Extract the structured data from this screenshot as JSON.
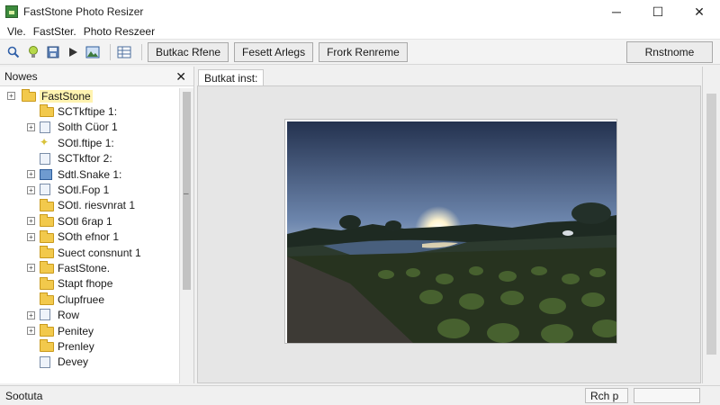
{
  "window": {
    "title": "FastStone Photo Resizer",
    "minimize_glyph": "─",
    "maximize_glyph": "☐",
    "close_glyph": "✕"
  },
  "menu": [
    "Vle.",
    "FastSter.",
    "Photo Reszeer"
  ],
  "toolbar": {
    "icons": [
      "search-icon",
      "bulb-icon",
      "save-icon",
      "play-icon",
      "image-icon",
      "grid-icon"
    ],
    "buttons": [
      "Butkac Rfene",
      "Fesett Arlegs",
      "Frork Renreme"
    ],
    "right_button": "Rnstnome"
  },
  "left_panel": {
    "header": "Nowes",
    "close_glyph": "✕",
    "tree": [
      {
        "label": "FastStone",
        "icon": "folder",
        "expander": true,
        "indent": 0,
        "selected": true
      },
      {
        "label": "SCTkftipe 1:",
        "icon": "folder",
        "expander": false,
        "indent": 1
      },
      {
        "label": "Solth Cüor 1",
        "icon": "file",
        "expander": true,
        "indent": 1
      },
      {
        "label": "SOtl.ftipe 1:",
        "icon": "star",
        "expander": false,
        "indent": 1
      },
      {
        "label": "SCTkftor 2:",
        "icon": "doc",
        "expander": false,
        "indent": 1
      },
      {
        "label": "Sdtl.Snake 1:",
        "icon": "image",
        "expander": true,
        "indent": 1
      },
      {
        "label": "SOtl.Fop 1",
        "icon": "file",
        "expander": true,
        "indent": 1
      },
      {
        "label": "SOtl. riesvnrat 1",
        "icon": "folder",
        "expander": false,
        "indent": 1
      },
      {
        "label": "SOtl 6rap 1",
        "icon": "folder",
        "expander": true,
        "indent": 1
      },
      {
        "label": "SOth efnor 1",
        "icon": "folder",
        "expander": true,
        "indent": 1
      },
      {
        "label": "Suect consnunt 1",
        "icon": "folder",
        "expander": false,
        "indent": 1
      },
      {
        "label": "FastStone.",
        "icon": "folder",
        "expander": true,
        "indent": 1
      },
      {
        "label": "Stapt fhope",
        "icon": "folder",
        "expander": false,
        "indent": 1
      },
      {
        "label": "Clupfruee",
        "icon": "folder",
        "expander": false,
        "indent": 1
      },
      {
        "label": "Row",
        "icon": "file",
        "expander": true,
        "indent": 1
      },
      {
        "label": "Penitey",
        "icon": "folder",
        "expander": true,
        "indent": 1
      },
      {
        "label": "Prenley",
        "icon": "folder",
        "expander": false,
        "indent": 1
      },
      {
        "label": "Devey",
        "icon": "file",
        "expander": false,
        "indent": 1
      }
    ]
  },
  "main": {
    "tab_label": "Butkat inst:"
  },
  "status": {
    "left_text": "Sootuta",
    "cell_text": "Rch p"
  }
}
